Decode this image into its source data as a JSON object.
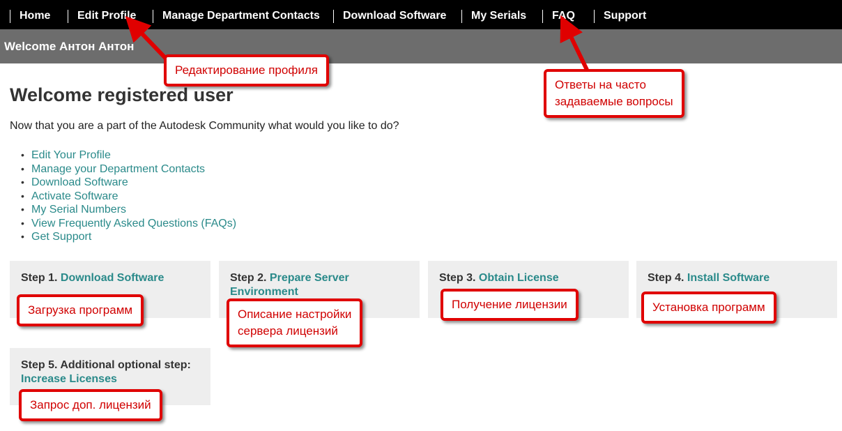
{
  "nav": {
    "items": [
      "Home",
      "Edit Profile",
      "Manage Department Contacts",
      "Download Software",
      "My Serials",
      "FAQ",
      "Support"
    ]
  },
  "welcome": "Welcome Антон Антон",
  "page_title": "Welcome registered user",
  "intro": "Now that you are a part of the Autodesk Community what would you like to do?",
  "actions": [
    "Edit Your Profile",
    "Manage your Department Contacts",
    "Download Software",
    "Activate Software",
    "My Serial Numbers",
    "View Frequently Asked Questions (FAQs)",
    "Get Support"
  ],
  "steps": [
    {
      "prefix": "Step 1.",
      "link": "Download Software"
    },
    {
      "prefix": "Step 2.",
      "link": "Prepare Server Environment"
    },
    {
      "prefix": "Step 3.",
      "link": "Obtain License"
    },
    {
      "prefix": "Step 4.",
      "link": "Install Software"
    },
    {
      "prefix": "Step 5. Additional optional step:",
      "link": "Increase Licenses"
    }
  ],
  "callouts": {
    "edit_profile": "Редактирование профиля",
    "faq_line1": "Ответы на часто",
    "faq_line2": "задаваемые вопросы",
    "step1": "Загрузка программ",
    "step2_line1": "Описание настройки",
    "step2_line2": "сервера лицензий",
    "step3": "Получение лицензии",
    "step4": "Установка программ",
    "step5": "Запрос доп. лицензий"
  },
  "colors": {
    "nav_bg": "#000000",
    "welcome_bg": "#6d6d6d",
    "link": "#2a8a8a",
    "callout_border": "#e00000",
    "callout_text": "#d00000",
    "step_bg": "#eeeeee"
  }
}
